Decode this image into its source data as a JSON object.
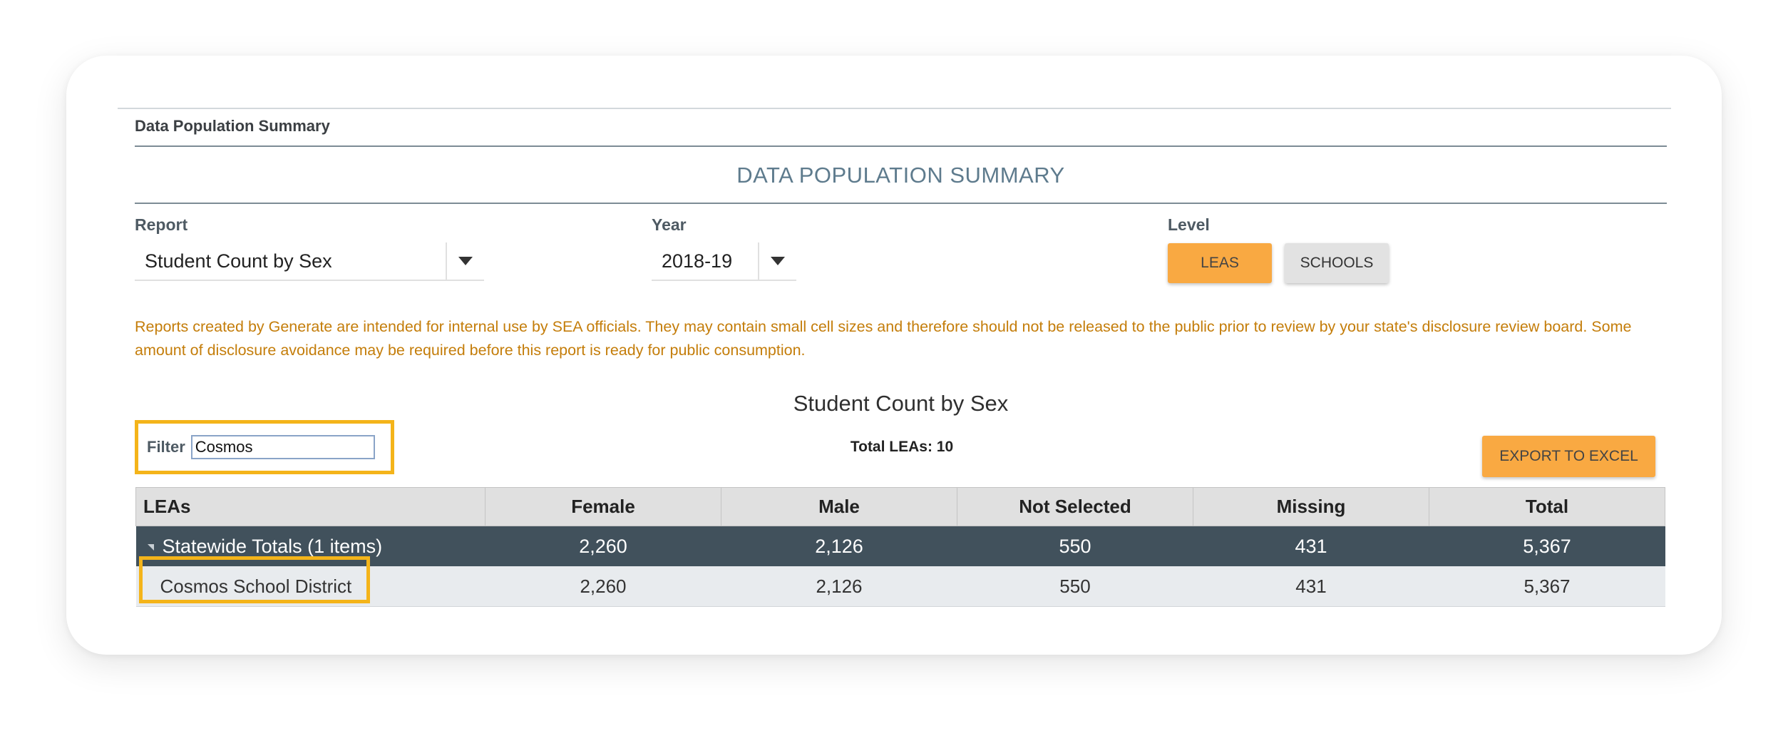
{
  "breadcrumb": "Data Population Summary",
  "page_title": "DATA POPULATION SUMMARY",
  "report": {
    "label": "Report",
    "selected": "Student Count by Sex"
  },
  "year": {
    "label": "Year",
    "selected": "2018-19"
  },
  "level": {
    "label": "Level",
    "buttons": [
      "LEAS",
      "SCHOOLS"
    ],
    "active": "LEAS"
  },
  "disclaimer": "Reports created by Generate are intended for internal use by SEA officials. They may contain small cell sizes and therefore should not be released to the public prior to review by your state's disclosure review board. Some amount of disclosure avoidance may be required before this report is ready for public consumption.",
  "report_title": "Student Count by Sex",
  "filter": {
    "label": "Filter",
    "value": "Cosmos"
  },
  "total_leas": "Total LEAs: 10",
  "export_label": "EXPORT TO EXCEL",
  "table": {
    "columns": [
      "LEAs",
      "Female",
      "Male",
      "Not Selected",
      "Missing",
      "Total"
    ],
    "group": {
      "label": "Statewide Totals (1 items)",
      "values": [
        "2,260",
        "2,126",
        "550",
        "431",
        "5,367"
      ]
    },
    "rows": [
      {
        "name": "Cosmos School District",
        "values": [
          "2,260",
          "2,126",
          "550",
          "431",
          "5,367"
        ]
      }
    ]
  },
  "colors": {
    "accent": "#f9a942",
    "highlight": "#f4b41a",
    "group_row": "#41515c",
    "disclaimer": "#c47d0a"
  }
}
